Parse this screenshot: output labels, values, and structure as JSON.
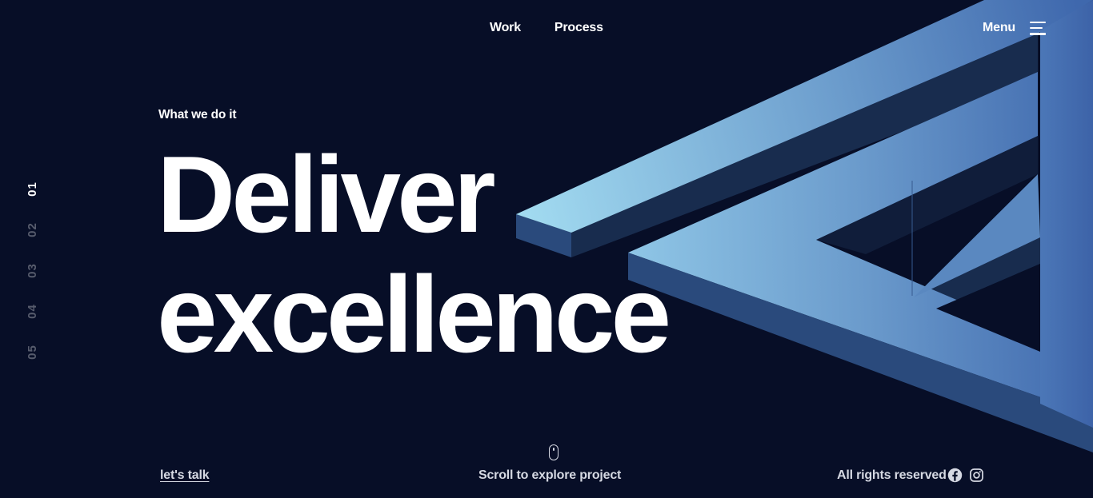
{
  "nav": {
    "items": [
      {
        "label": "Work"
      },
      {
        "label": "Process"
      }
    ],
    "menu_label": "Menu"
  },
  "hero": {
    "eyebrow": "What we do it",
    "headline_line1": "Deliver",
    "headline_line2": "excellence"
  },
  "slide_index": {
    "items": [
      "01",
      "02",
      "03",
      "04",
      "05"
    ],
    "active": "01"
  },
  "footer": {
    "cta": "let's talk",
    "scroll_hint": "Scroll to explore project",
    "rights": "All rights reserved"
  },
  "icons": {
    "menu": "hamburger-icon",
    "scroll": "mouse-icon",
    "social": [
      "facebook-icon",
      "instagram-icon"
    ]
  },
  "colors": {
    "background": "#070e27",
    "accent_light": "#a1dbf0",
    "accent_dark": "#3d65ab",
    "text_muted": "#d5d8e2"
  }
}
